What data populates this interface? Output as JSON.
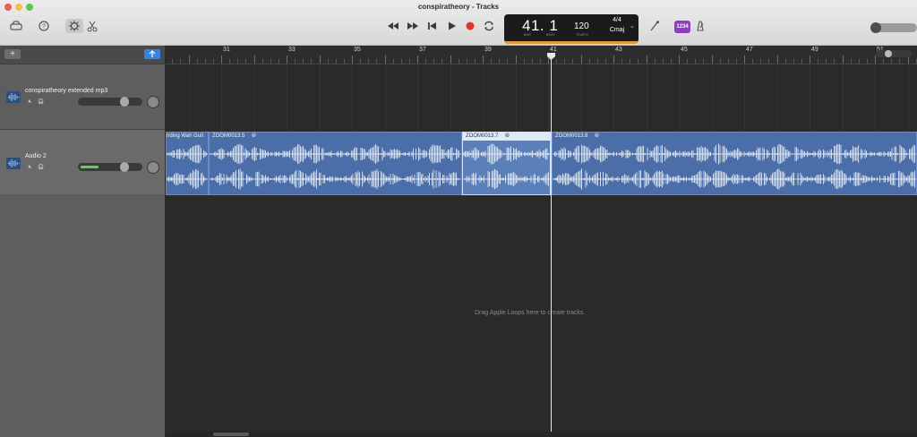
{
  "window": {
    "title": "conspiratheory - Tracks"
  },
  "toolbar": {
    "lcd": {
      "position": "41. 1",
      "bar_caption": "BAR",
      "beat_caption": "BEAT",
      "tempo": "120",
      "tempo_caption": "TEMPO",
      "time_signature": "4/4",
      "key": "Cmaj"
    },
    "count_in_label": "1234"
  },
  "header": {
    "add_label": "+"
  },
  "ruler": {
    "bars": [
      "31",
      "33",
      "35",
      "37",
      "39",
      "41",
      "43",
      "45",
      "47",
      "49",
      "51"
    ]
  },
  "tracks": [
    {
      "name": "conspiratheory extended mp3",
      "volume": 0.72
    },
    {
      "name": "Audio 2",
      "volume": 0.72
    }
  ],
  "regions": [
    {
      "label": "nding Wah Guit"
    },
    {
      "label": "ZOOM0013.5"
    },
    {
      "label": "ZOOM0013.7"
    },
    {
      "label": "ZOOM0013.8"
    }
  ],
  "empty_hint": "Drag Apple Loops here to create tracks.",
  "colors": {
    "region": "#4b6ea8",
    "accent": "#3a82e0",
    "lcd_bar": "#e39a3a",
    "record": "#e0342f"
  }
}
